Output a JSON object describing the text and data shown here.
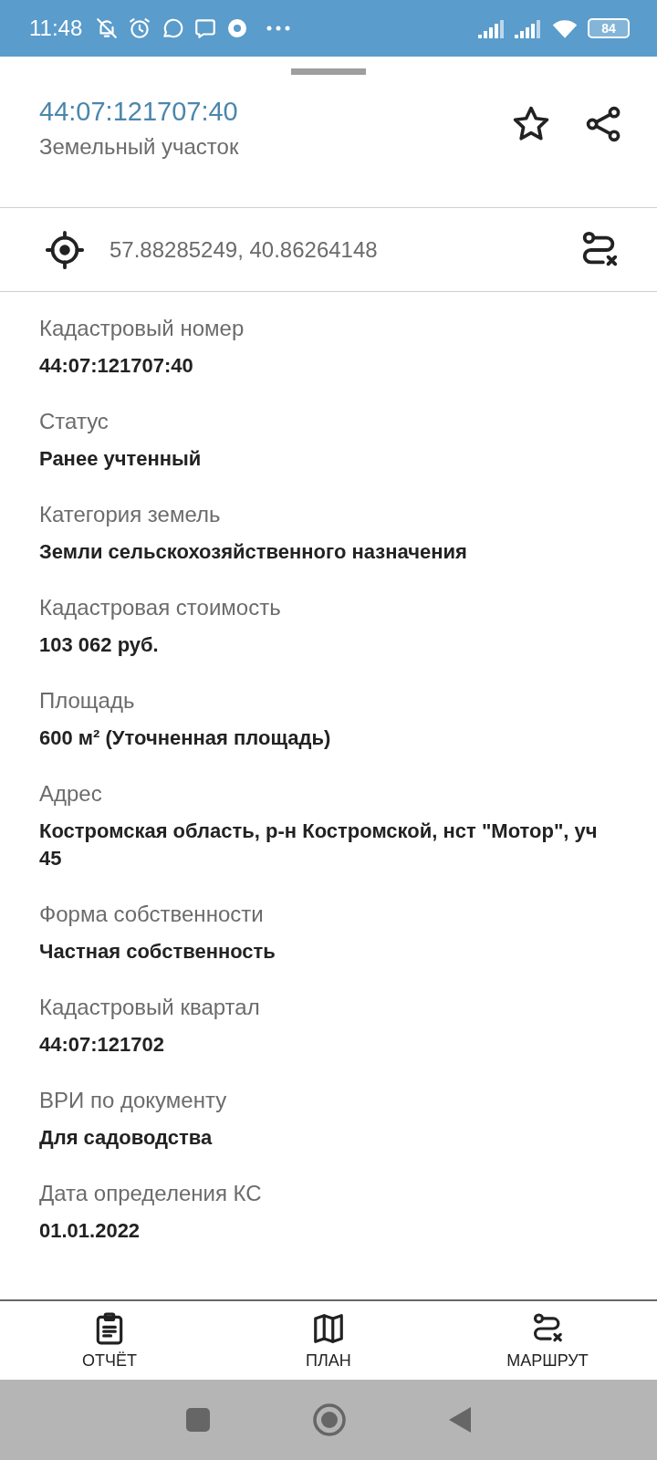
{
  "status_bar": {
    "time": "11:48",
    "battery": "84"
  },
  "header": {
    "title": "44:07:121707:40",
    "subtitle": "Земельный участок",
    "favorite": false
  },
  "coordinates": "57.88285249, 40.86264148",
  "fields": [
    {
      "label": "Кадастровый номер",
      "value": "44:07:121707:40"
    },
    {
      "label": "Статус",
      "value": "Ранее учтенный"
    },
    {
      "label": "Категория земель",
      "value": "Земли сельскохозяйственного назначения"
    },
    {
      "label": "Кадастровая стоимость",
      "value": "103 062 руб."
    },
    {
      "label": "Площадь",
      "value": "600 м² (Уточненная площадь)"
    },
    {
      "label": "Адрес",
      "value": "Костромская область, р-н Костромской, нст \"Мотор\", уч 45"
    },
    {
      "label": "Форма собственности",
      "value": "Частная собственность"
    },
    {
      "label": "Кадастровый квартал",
      "value": "44:07:121702"
    },
    {
      "label": "ВРИ по документу",
      "value": "Для садоводства"
    },
    {
      "label": "Дата определения КС",
      "value": "01.01.2022"
    }
  ],
  "bottom_actions": [
    {
      "kind": "report",
      "label": "ОТЧЁТ"
    },
    {
      "kind": "plan",
      "label": "ПЛАН"
    },
    {
      "kind": "route",
      "label": "МАРШРУТ"
    }
  ]
}
